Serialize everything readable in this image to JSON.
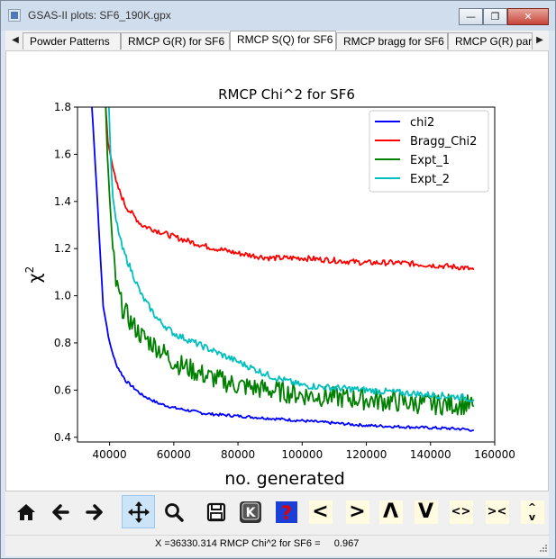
{
  "window": {
    "title": "GSAS-II plots: SF6_190K.gpx",
    "controls": {
      "minimize": "—",
      "maximize": "❐",
      "close": "✕"
    }
  },
  "tabs": [
    {
      "label": "Powder Patterns"
    },
    {
      "label": "RMCP G(R) for SF6"
    },
    {
      "label": "RMCP S(Q) for SF6"
    },
    {
      "label": "RMCP bragg for SF6"
    },
    {
      "label": "RMCP G(R) part"
    }
  ],
  "toolbar": {
    "buttons": [
      {
        "name": "home",
        "icon": "home-icon"
      },
      {
        "name": "back",
        "icon": "arrow-left-icon"
      },
      {
        "name": "forward",
        "icon": "arrow-right-icon"
      },
      {
        "name": "pan",
        "icon": "move-icon",
        "active": true
      },
      {
        "name": "zoom",
        "icon": "magnifier-icon"
      },
      {
        "name": "save",
        "icon": "floppy-icon"
      },
      {
        "name": "key-press",
        "icon": "k-key-icon"
      },
      {
        "name": "help",
        "icon": "question-icon"
      },
      {
        "name": "shift-left",
        "label": "<"
      },
      {
        "name": "shift-right",
        "label": ">"
      },
      {
        "name": "shift-up",
        "label": "Λ"
      },
      {
        "name": "shift-down",
        "label": "V"
      },
      {
        "name": "expand-x",
        "label": "<>"
      },
      {
        "name": "contract-x",
        "label": "><"
      },
      {
        "name": "expand-y",
        "label": "^\nv"
      }
    ]
  },
  "status": {
    "text": "X =36330.314 RMCP Chi^2 for SF6 =     0.967"
  },
  "chart_data": {
    "type": "line",
    "title": "RMCP Chi^2 for SF6",
    "xlabel": "no. generated",
    "ylabel": "χ2",
    "xlim": [
      30000,
      160000
    ],
    "ylim": [
      0.38,
      1.8
    ],
    "xticks": [
      40000,
      60000,
      80000,
      100000,
      120000,
      140000,
      160000
    ],
    "yticks": [
      0.4,
      0.6,
      0.8,
      1.0,
      1.2,
      1.4,
      1.6,
      1.8
    ],
    "grid": false,
    "legend": "top-right",
    "series": [
      {
        "name": "chi2",
        "color": "#0000ff",
        "x": [
          34500,
          36000,
          37000,
          38000,
          40000,
          42000,
          45000,
          50000,
          55000,
          60000,
          70000,
          80000,
          90000,
          100000,
          110000,
          120000,
          130000,
          140000,
          150000,
          153500
        ],
        "y": [
          1.8,
          1.45,
          1.2,
          0.96,
          0.8,
          0.71,
          0.64,
          0.58,
          0.545,
          0.525,
          0.5,
          0.49,
          0.48,
          0.47,
          0.46,
          0.45,
          0.445,
          0.44,
          0.435,
          0.43
        ]
      },
      {
        "name": "Bragg_Chi2",
        "color": "#ff0000",
        "x": [
          38800,
          39500,
          40500,
          42000,
          45000,
          50000,
          60000,
          70000,
          80000,
          90000,
          100000,
          110000,
          120000,
          130000,
          140000,
          150000,
          153500
        ],
        "y": [
          1.8,
          1.65,
          1.58,
          1.48,
          1.38,
          1.3,
          1.25,
          1.21,
          1.18,
          1.16,
          1.16,
          1.15,
          1.14,
          1.14,
          1.13,
          1.12,
          1.11
        ]
      },
      {
        "name": "Expt_1",
        "color": "#008000",
        "x": [
          38800,
          39300,
          40000,
          41000,
          42000,
          44000,
          47000,
          50000,
          55000,
          60000,
          70000,
          80000,
          90000,
          100000,
          110000,
          120000,
          130000,
          140000,
          150000,
          153500
        ],
        "y": [
          1.8,
          1.6,
          1.42,
          1.2,
          1.05,
          0.95,
          0.88,
          0.83,
          0.78,
          0.72,
          0.66,
          0.62,
          0.6,
          0.58,
          0.57,
          0.56,
          0.55,
          0.54,
          0.54,
          0.53
        ]
      },
      {
        "name": "Expt_2",
        "color": "#00bfbf",
        "x": [
          39800,
          40300,
          41000,
          42000,
          44000,
          47000,
          50000,
          55000,
          60000,
          70000,
          80000,
          90000,
          100000,
          110000,
          120000,
          130000,
          140000,
          150000,
          153500
        ],
        "y": [
          1.8,
          1.6,
          1.42,
          1.32,
          1.2,
          1.1,
          1.0,
          0.9,
          0.84,
          0.78,
          0.72,
          0.66,
          0.62,
          0.61,
          0.6,
          0.59,
          0.58,
          0.57,
          0.56
        ]
      }
    ]
  }
}
